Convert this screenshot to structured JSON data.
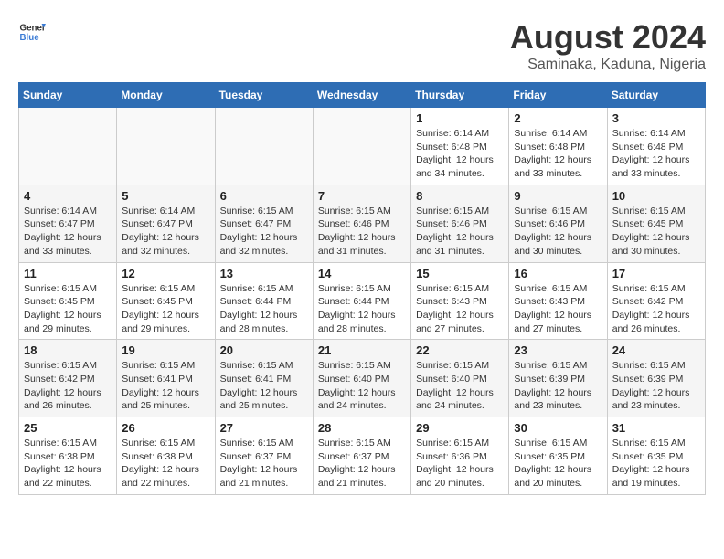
{
  "header": {
    "logo_general": "General",
    "logo_blue": "Blue",
    "title": "August 2024",
    "subtitle": "Saminaka, Kaduna, Nigeria"
  },
  "weekdays": [
    "Sunday",
    "Monday",
    "Tuesday",
    "Wednesday",
    "Thursday",
    "Friday",
    "Saturday"
  ],
  "weeks": [
    [
      {
        "day": "",
        "detail": ""
      },
      {
        "day": "",
        "detail": ""
      },
      {
        "day": "",
        "detail": ""
      },
      {
        "day": "",
        "detail": ""
      },
      {
        "day": "1",
        "detail": "Sunrise: 6:14 AM\nSunset: 6:48 PM\nDaylight: 12 hours\nand 34 minutes."
      },
      {
        "day": "2",
        "detail": "Sunrise: 6:14 AM\nSunset: 6:48 PM\nDaylight: 12 hours\nand 33 minutes."
      },
      {
        "day": "3",
        "detail": "Sunrise: 6:14 AM\nSunset: 6:48 PM\nDaylight: 12 hours\nand 33 minutes."
      }
    ],
    [
      {
        "day": "4",
        "detail": "Sunrise: 6:14 AM\nSunset: 6:47 PM\nDaylight: 12 hours\nand 33 minutes."
      },
      {
        "day": "5",
        "detail": "Sunrise: 6:14 AM\nSunset: 6:47 PM\nDaylight: 12 hours\nand 32 minutes."
      },
      {
        "day": "6",
        "detail": "Sunrise: 6:15 AM\nSunset: 6:47 PM\nDaylight: 12 hours\nand 32 minutes."
      },
      {
        "day": "7",
        "detail": "Sunrise: 6:15 AM\nSunset: 6:46 PM\nDaylight: 12 hours\nand 31 minutes."
      },
      {
        "day": "8",
        "detail": "Sunrise: 6:15 AM\nSunset: 6:46 PM\nDaylight: 12 hours\nand 31 minutes."
      },
      {
        "day": "9",
        "detail": "Sunrise: 6:15 AM\nSunset: 6:46 PM\nDaylight: 12 hours\nand 30 minutes."
      },
      {
        "day": "10",
        "detail": "Sunrise: 6:15 AM\nSunset: 6:45 PM\nDaylight: 12 hours\nand 30 minutes."
      }
    ],
    [
      {
        "day": "11",
        "detail": "Sunrise: 6:15 AM\nSunset: 6:45 PM\nDaylight: 12 hours\nand 29 minutes."
      },
      {
        "day": "12",
        "detail": "Sunrise: 6:15 AM\nSunset: 6:45 PM\nDaylight: 12 hours\nand 29 minutes."
      },
      {
        "day": "13",
        "detail": "Sunrise: 6:15 AM\nSunset: 6:44 PM\nDaylight: 12 hours\nand 28 minutes."
      },
      {
        "day": "14",
        "detail": "Sunrise: 6:15 AM\nSunset: 6:44 PM\nDaylight: 12 hours\nand 28 minutes."
      },
      {
        "day": "15",
        "detail": "Sunrise: 6:15 AM\nSunset: 6:43 PM\nDaylight: 12 hours\nand 27 minutes."
      },
      {
        "day": "16",
        "detail": "Sunrise: 6:15 AM\nSunset: 6:43 PM\nDaylight: 12 hours\nand 27 minutes."
      },
      {
        "day": "17",
        "detail": "Sunrise: 6:15 AM\nSunset: 6:42 PM\nDaylight: 12 hours\nand 26 minutes."
      }
    ],
    [
      {
        "day": "18",
        "detail": "Sunrise: 6:15 AM\nSunset: 6:42 PM\nDaylight: 12 hours\nand 26 minutes."
      },
      {
        "day": "19",
        "detail": "Sunrise: 6:15 AM\nSunset: 6:41 PM\nDaylight: 12 hours\nand 25 minutes."
      },
      {
        "day": "20",
        "detail": "Sunrise: 6:15 AM\nSunset: 6:41 PM\nDaylight: 12 hours\nand 25 minutes."
      },
      {
        "day": "21",
        "detail": "Sunrise: 6:15 AM\nSunset: 6:40 PM\nDaylight: 12 hours\nand 24 minutes."
      },
      {
        "day": "22",
        "detail": "Sunrise: 6:15 AM\nSunset: 6:40 PM\nDaylight: 12 hours\nand 24 minutes."
      },
      {
        "day": "23",
        "detail": "Sunrise: 6:15 AM\nSunset: 6:39 PM\nDaylight: 12 hours\nand 23 minutes."
      },
      {
        "day": "24",
        "detail": "Sunrise: 6:15 AM\nSunset: 6:39 PM\nDaylight: 12 hours\nand 23 minutes."
      }
    ],
    [
      {
        "day": "25",
        "detail": "Sunrise: 6:15 AM\nSunset: 6:38 PM\nDaylight: 12 hours\nand 22 minutes."
      },
      {
        "day": "26",
        "detail": "Sunrise: 6:15 AM\nSunset: 6:38 PM\nDaylight: 12 hours\nand 22 minutes."
      },
      {
        "day": "27",
        "detail": "Sunrise: 6:15 AM\nSunset: 6:37 PM\nDaylight: 12 hours\nand 21 minutes."
      },
      {
        "day": "28",
        "detail": "Sunrise: 6:15 AM\nSunset: 6:37 PM\nDaylight: 12 hours\nand 21 minutes."
      },
      {
        "day": "29",
        "detail": "Sunrise: 6:15 AM\nSunset: 6:36 PM\nDaylight: 12 hours\nand 20 minutes."
      },
      {
        "day": "30",
        "detail": "Sunrise: 6:15 AM\nSunset: 6:35 PM\nDaylight: 12 hours\nand 20 minutes."
      },
      {
        "day": "31",
        "detail": "Sunrise: 6:15 AM\nSunset: 6:35 PM\nDaylight: 12 hours\nand 19 minutes."
      }
    ]
  ]
}
